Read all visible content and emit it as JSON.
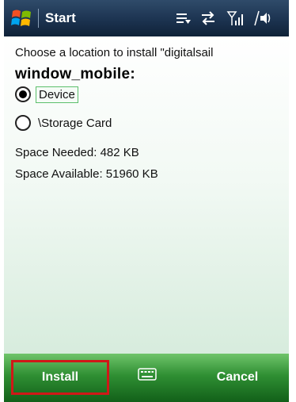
{
  "titlebar": {
    "title": "Start",
    "logo_icon": "windows-flag-icon",
    "status_icons": [
      "notifications-icon",
      "connectivity-icon",
      "signal-strength-icon",
      "volume-icon"
    ]
  },
  "content": {
    "prompt": "Choose a location to install \"digitalsail",
    "app_name": "window_mobile:",
    "options": [
      {
        "label": "Device",
        "checked": true
      },
      {
        "label": "\\Storage Card",
        "checked": false
      }
    ],
    "space_needed": "Space Needed:  482 KB",
    "space_available": "Space Available: 51960 KB"
  },
  "softkeys": {
    "left": "Install",
    "right": "Cancel",
    "center_icon": "keyboard-icon"
  },
  "colors": {
    "titlebar": "#1c3350",
    "softbar": "#2f8f33",
    "highlight": "#d01818",
    "focus": "#5cbf6c"
  }
}
